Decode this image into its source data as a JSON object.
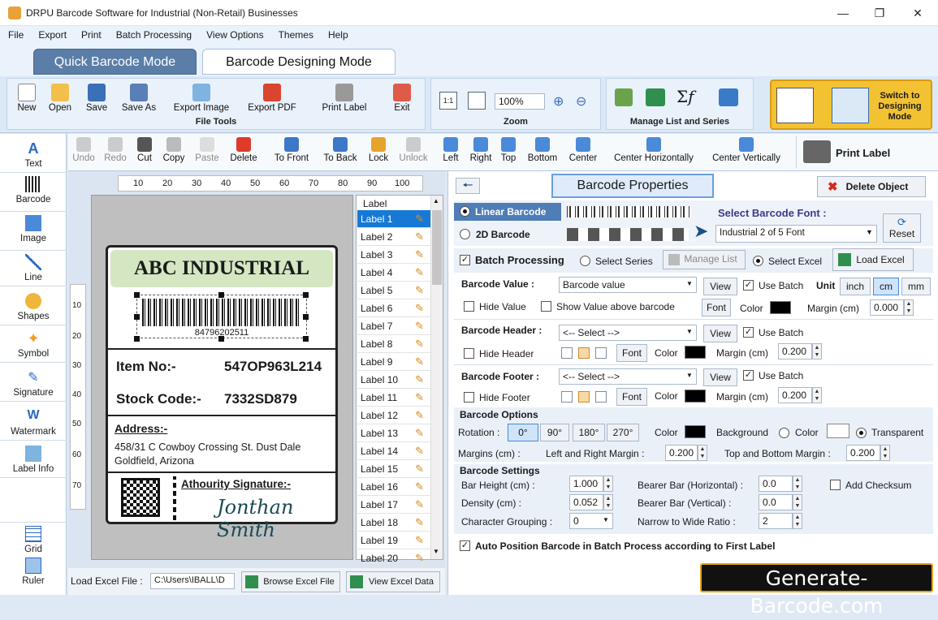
{
  "app": {
    "title": "DRPU Barcode Software for Industrial (Non-Retail) Businesses"
  },
  "menu": [
    "File",
    "Export",
    "Print",
    "Batch Processing",
    "View Options",
    "Themes",
    "Help"
  ],
  "modes": {
    "quick": "Quick Barcode Mode",
    "designing": "Barcode Designing Mode"
  },
  "ribbon": {
    "file_tools": {
      "label": "File Tools",
      "buttons": [
        "New",
        "Open",
        "Save",
        "Save As",
        "Export Image",
        "Export PDF",
        "Print Label",
        "Exit"
      ]
    },
    "zoom": {
      "label": "Zoom",
      "value": "100%"
    },
    "manage": {
      "label": "Manage List and Series"
    },
    "switch": "Switch to Designing Mode"
  },
  "toolbar": {
    "buttons": [
      "Undo",
      "Redo",
      "Cut",
      "Copy",
      "Paste",
      "Delete",
      "To Front",
      "To Back",
      "Lock",
      "Unlock",
      "Left",
      "Right",
      "Top",
      "Bottom",
      "Center",
      "Center Horizontally",
      "Center Vertically"
    ],
    "print_label": "Print Label"
  },
  "left_tools": [
    "Text",
    "Barcode",
    "Image",
    "Line",
    "Shapes",
    "Symbol",
    "Signature",
    "Watermark",
    "Label Info",
    "Grid",
    "Ruler"
  ],
  "ruler": {
    "h_ticks": [
      "10",
      "20",
      "30",
      "40",
      "50",
      "60",
      "70",
      "80",
      "90",
      "100"
    ],
    "v_ticks": [
      "10",
      "20",
      "30",
      "40",
      "50",
      "60",
      "70"
    ]
  },
  "label_design": {
    "company": "ABC INDUSTRIAL",
    "barcode_number": "84796202511",
    "item_key": "Item No:-",
    "item_val": "547OP963L214",
    "stock_key": "Stock Code:-",
    "stock_val": "7332SD879",
    "address_key": "Address:-",
    "address_line1": "458/31 C Cowboy Crossing St. Dust Dale",
    "address_line2": "Goldfield, Arizona",
    "signature_key": "Athourity Signature:-",
    "signature_val": "Jonthan Smith"
  },
  "label_list": {
    "header": "Label",
    "items": [
      "Label 1",
      "Label 2",
      "Label 3",
      "Label 4",
      "Label 5",
      "Label 6",
      "Label 7",
      "Label 8",
      "Label 9",
      "Label 10",
      "Label 11",
      "Label 12",
      "Label 13",
      "Label 14",
      "Label 15",
      "Label 16",
      "Label 17",
      "Label 18",
      "Label 19",
      "Label 20"
    ],
    "selected_index": 0
  },
  "bottom": {
    "load_label": "Load Excel File :",
    "path": "C:\\Users\\IBALL\\D",
    "browse": "Browse Excel File",
    "view": "View Excel Data"
  },
  "props": {
    "title": "Barcode Properties",
    "delete_object": "Delete Object",
    "linear": "Linear Barcode",
    "twod": "2D Barcode",
    "select_font_label": "Select Barcode Font :",
    "font_value": "Industrial 2 of 5 Font",
    "reset": "Reset",
    "batch": "Batch Processing",
    "select_series": "Select Series",
    "manage_list": "Manage List",
    "select_excel": "Select Excel",
    "load_excel": "Load Excel",
    "value_label": "Barcode Value :",
    "value_field": "Barcode value",
    "view": "View",
    "use_batch": "Use Batch",
    "unit": "Unit",
    "units": [
      "inch",
      "cm",
      "mm"
    ],
    "hide_value": "Hide Value",
    "show_above": "Show Value above barcode",
    "font": "Font",
    "color": "Color",
    "margin_cm": "Margin (cm)",
    "value_margin": "0.000",
    "header_label": "Barcode Header :",
    "select_placeholder": "<-- Select -->",
    "hide_header": "Hide Header",
    "header_margin": "0.200",
    "footer_label": "Barcode Footer :",
    "hide_footer": "Hide Footer",
    "footer_margin": "0.200",
    "options_title": "Barcode Options",
    "rotation": "Rotation :",
    "rotations": [
      "0°",
      "90°",
      "180°",
      "270°"
    ],
    "background": "Background",
    "color_opt": "Color",
    "transparent": "Transparent",
    "margins_cm": "Margins (cm) :",
    "lr_margin": "Left and Right Margin :",
    "lr_value": "0.200",
    "tb_margin": "Top and Bottom Margin :",
    "tb_value": "0.200",
    "settings_title": "Barcode Settings",
    "bar_height": "Bar Height (cm) :",
    "bar_height_v": "1.000",
    "density": "Density (cm) :",
    "density_v": "0.052",
    "char_group": "Character Grouping :",
    "char_group_v": "0",
    "bearer_h": "Bearer Bar (Horizontal) :",
    "bearer_h_v": "0.0",
    "bearer_v": "Bearer Bar (Vertical) :",
    "bearer_v_v": "0.0",
    "narrow_wide": "Narrow to Wide Ratio :",
    "narrow_wide_v": "2",
    "add_checksum": "Add Checksum",
    "auto_position": "Auto Position Barcode in Batch Process according to First Label"
  },
  "watermark": "Generate-Barcode.com"
}
